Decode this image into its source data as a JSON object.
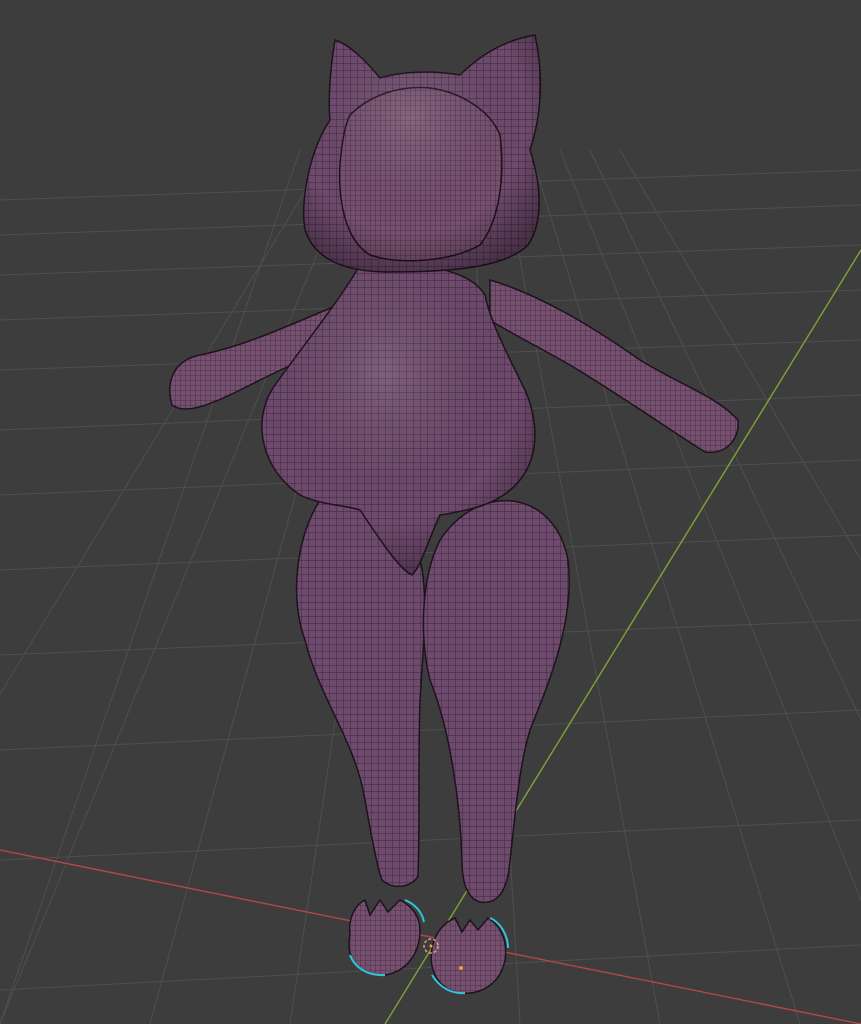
{
  "viewport": {
    "background": "#3d3d3d",
    "grid_color": "#4f4f4f",
    "axis_x_color": "#b4474c",
    "axis_y_color": "#7ea336",
    "mesh_fill": "#6e4a6c",
    "mesh_wire": "#2a1a2a",
    "selection_color": "#2fc6d8",
    "cursor_color": "#e0a07a"
  }
}
